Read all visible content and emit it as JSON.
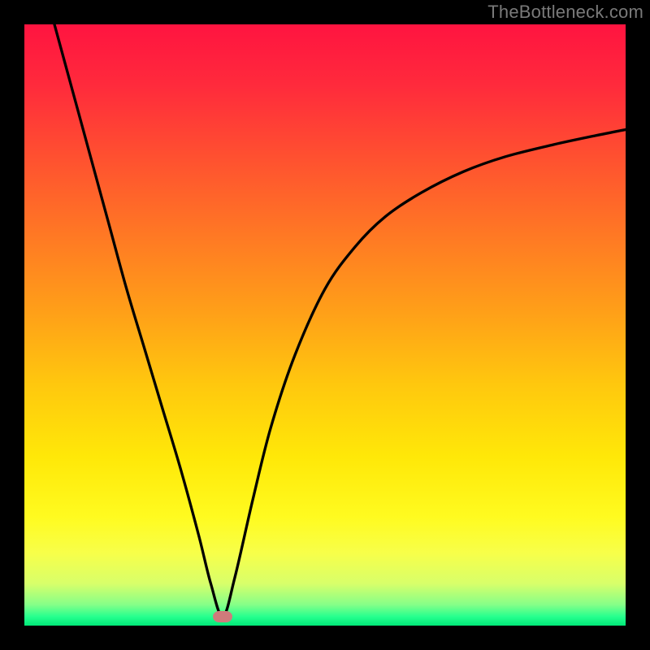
{
  "watermark": "TheBottleneck.com",
  "colors": {
    "frame": "#000000",
    "curve": "#000000",
    "marker": "#cf7b7b",
    "gradient_stops": [
      {
        "pct": 0.0,
        "hex": "#ff1440"
      },
      {
        "pct": 0.1,
        "hex": "#ff2a3c"
      },
      {
        "pct": 0.22,
        "hex": "#ff5030"
      },
      {
        "pct": 0.35,
        "hex": "#ff7824"
      },
      {
        "pct": 0.48,
        "hex": "#ffa018"
      },
      {
        "pct": 0.6,
        "hex": "#ffc80e"
      },
      {
        "pct": 0.72,
        "hex": "#ffe808"
      },
      {
        "pct": 0.82,
        "hex": "#fffb20"
      },
      {
        "pct": 0.88,
        "hex": "#f7ff4a"
      },
      {
        "pct": 0.93,
        "hex": "#d8ff6a"
      },
      {
        "pct": 0.965,
        "hex": "#86ff88"
      },
      {
        "pct": 0.985,
        "hex": "#26ff8e"
      },
      {
        "pct": 1.0,
        "hex": "#00e878"
      }
    ]
  },
  "chart_data": {
    "type": "line",
    "title": "",
    "xlabel": "",
    "ylabel": "",
    "xlim": [
      0,
      100
    ],
    "ylim": [
      0,
      100
    ],
    "marker": {
      "x": 33,
      "y": 1.5
    },
    "series": [
      {
        "name": "left-branch",
        "x": [
          5,
          8,
          11,
          14,
          17,
          20,
          23,
          26,
          29,
          31,
          33
        ],
        "values": [
          100,
          89,
          78,
          67,
          56,
          46,
          36,
          26,
          15,
          7,
          1.5
        ]
      },
      {
        "name": "right-branch",
        "x": [
          33,
          35,
          38,
          41,
          45,
          50,
          55,
          60,
          66,
          73,
          80,
          88,
          95,
          100
        ],
        "values": [
          1.5,
          8,
          21,
          33,
          45,
          56,
          63,
          68,
          72,
          75.5,
          78,
          80,
          81.5,
          82.5
        ]
      }
    ]
  }
}
